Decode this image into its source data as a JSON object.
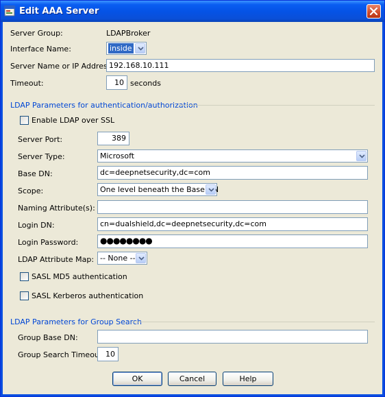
{
  "window": {
    "title": "Edit AAA Server",
    "icons": {
      "app": "app-icon",
      "close": "close-icon"
    }
  },
  "server_group": {
    "label": "Server Group:",
    "value": "LDAPBroker"
  },
  "interface_name": {
    "label": "Interface Name:",
    "value": "inside"
  },
  "server_address": {
    "label": "Server Name or IP Address:",
    "value": "192.168.10.111"
  },
  "timeout": {
    "label": "Timeout:",
    "value": "10",
    "unit": "seconds"
  },
  "ldap_auth_section": {
    "title": "LDAP Parameters for authentication/authorization",
    "enable_ssl": {
      "label": "Enable LDAP over SSL",
      "checked": false
    },
    "server_port": {
      "label": "Server Port:",
      "value": "389"
    },
    "server_type": {
      "label": "Server Type:",
      "value": "Microsoft"
    },
    "base_dn": {
      "label": "Base DN:",
      "value": "dc=deepnetsecurity,dc=com"
    },
    "scope": {
      "label": "Scope:",
      "value": "One level beneath the Base DN"
    },
    "naming_attribute": {
      "label": "Naming Attribute(s):",
      "value": ""
    },
    "login_dn": {
      "label": "Login DN:",
      "value": "cn=dualshield,dc=deepnetsecurity,dc=com"
    },
    "login_password": {
      "label": "Login Password:",
      "value": "●●●●●●●●"
    },
    "attribute_map": {
      "label": "LDAP Attribute Map:",
      "value": "-- None --"
    },
    "sasl_md5": {
      "label": "SASL MD5 authentication",
      "checked": false
    },
    "sasl_kerberos": {
      "label": "SASL Kerberos authentication",
      "checked": false
    }
  },
  "group_search_section": {
    "title": "LDAP Parameters for Group Search",
    "group_base_dn": {
      "label": "Group Base DN:",
      "value": ""
    },
    "group_search_timeout": {
      "label": "Group Search Timeout:",
      "value": "10"
    }
  },
  "buttons": {
    "ok": "OK",
    "cancel": "Cancel",
    "help": "Help"
  },
  "colors": {
    "section_title": "#0046d5",
    "titlebar": "#0a5ef2",
    "dialog_bg": "#ece9d8"
  }
}
